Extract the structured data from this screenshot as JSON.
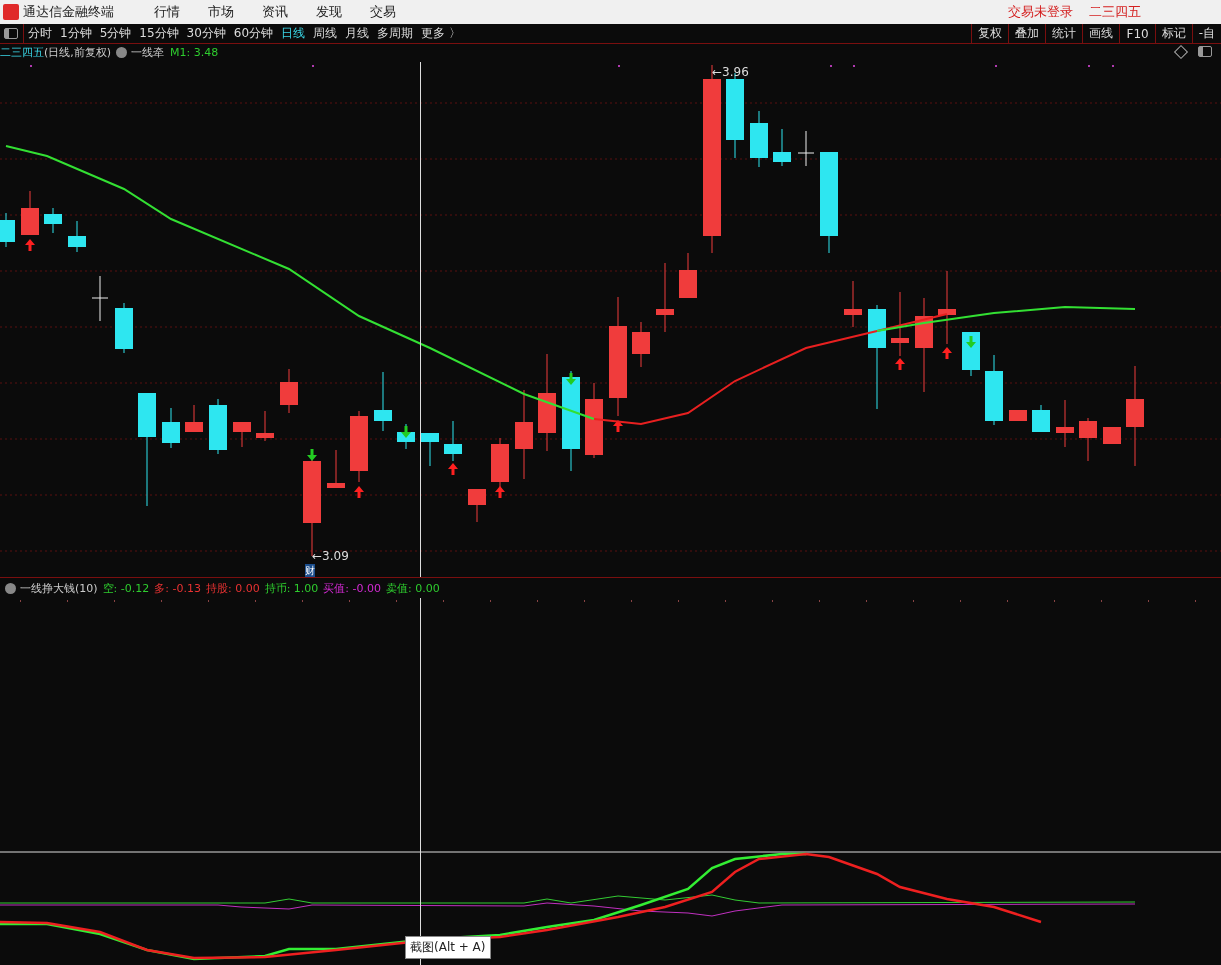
{
  "menu_bar": {
    "app_title": "通达信金融终端",
    "menus": [
      "行情",
      "市场",
      "资讯",
      "发现",
      "交易"
    ],
    "login_status": "交易未登录",
    "user_name": "二三四五"
  },
  "toolbar": {
    "periods": [
      {
        "label": "分时",
        "selected": false
      },
      {
        "label": "1分钟",
        "selected": false
      },
      {
        "label": "5分钟",
        "selected": false
      },
      {
        "label": "15分钟",
        "selected": false
      },
      {
        "label": "30分钟",
        "selected": false
      },
      {
        "label": "60分钟",
        "selected": false
      },
      {
        "label": "日线",
        "selected": true
      },
      {
        "label": "周线",
        "selected": false
      },
      {
        "label": "月线",
        "selected": false
      },
      {
        "label": "多周期",
        "selected": false
      },
      {
        "label": "更多 〉",
        "selected": false
      }
    ],
    "tools": [
      "复权",
      "叠加",
      "统计",
      "画线",
      "F10",
      "标记",
      "-自"
    ]
  },
  "main_chart": {
    "stock_name": "二三四五",
    "period_label": "(日线,前复权)",
    "indicator_name": "一线牵",
    "indicator_value": "M1: 3.48",
    "high_label": "←3.96",
    "low_label": "←3.09",
    "event_badge": "财"
  },
  "indicator_panel": {
    "name": "一线挣大钱(10)",
    "values": [
      {
        "text": "空: -0.12",
        "color": "#2ecc2e"
      },
      {
        "text": "多: -0.13",
        "color": "#e83232"
      },
      {
        "text": "持股: 0.00",
        "color": "#e83232"
      },
      {
        "text": "持币: 1.00",
        "color": "#2ecc2e"
      },
      {
        "text": "买值: -0.00",
        "color": "#d22ad2"
      },
      {
        "text": "卖值: 0.00",
        "color": "#2ecc2e"
      }
    ]
  },
  "tooltip": "截图(Alt + A)"
}
